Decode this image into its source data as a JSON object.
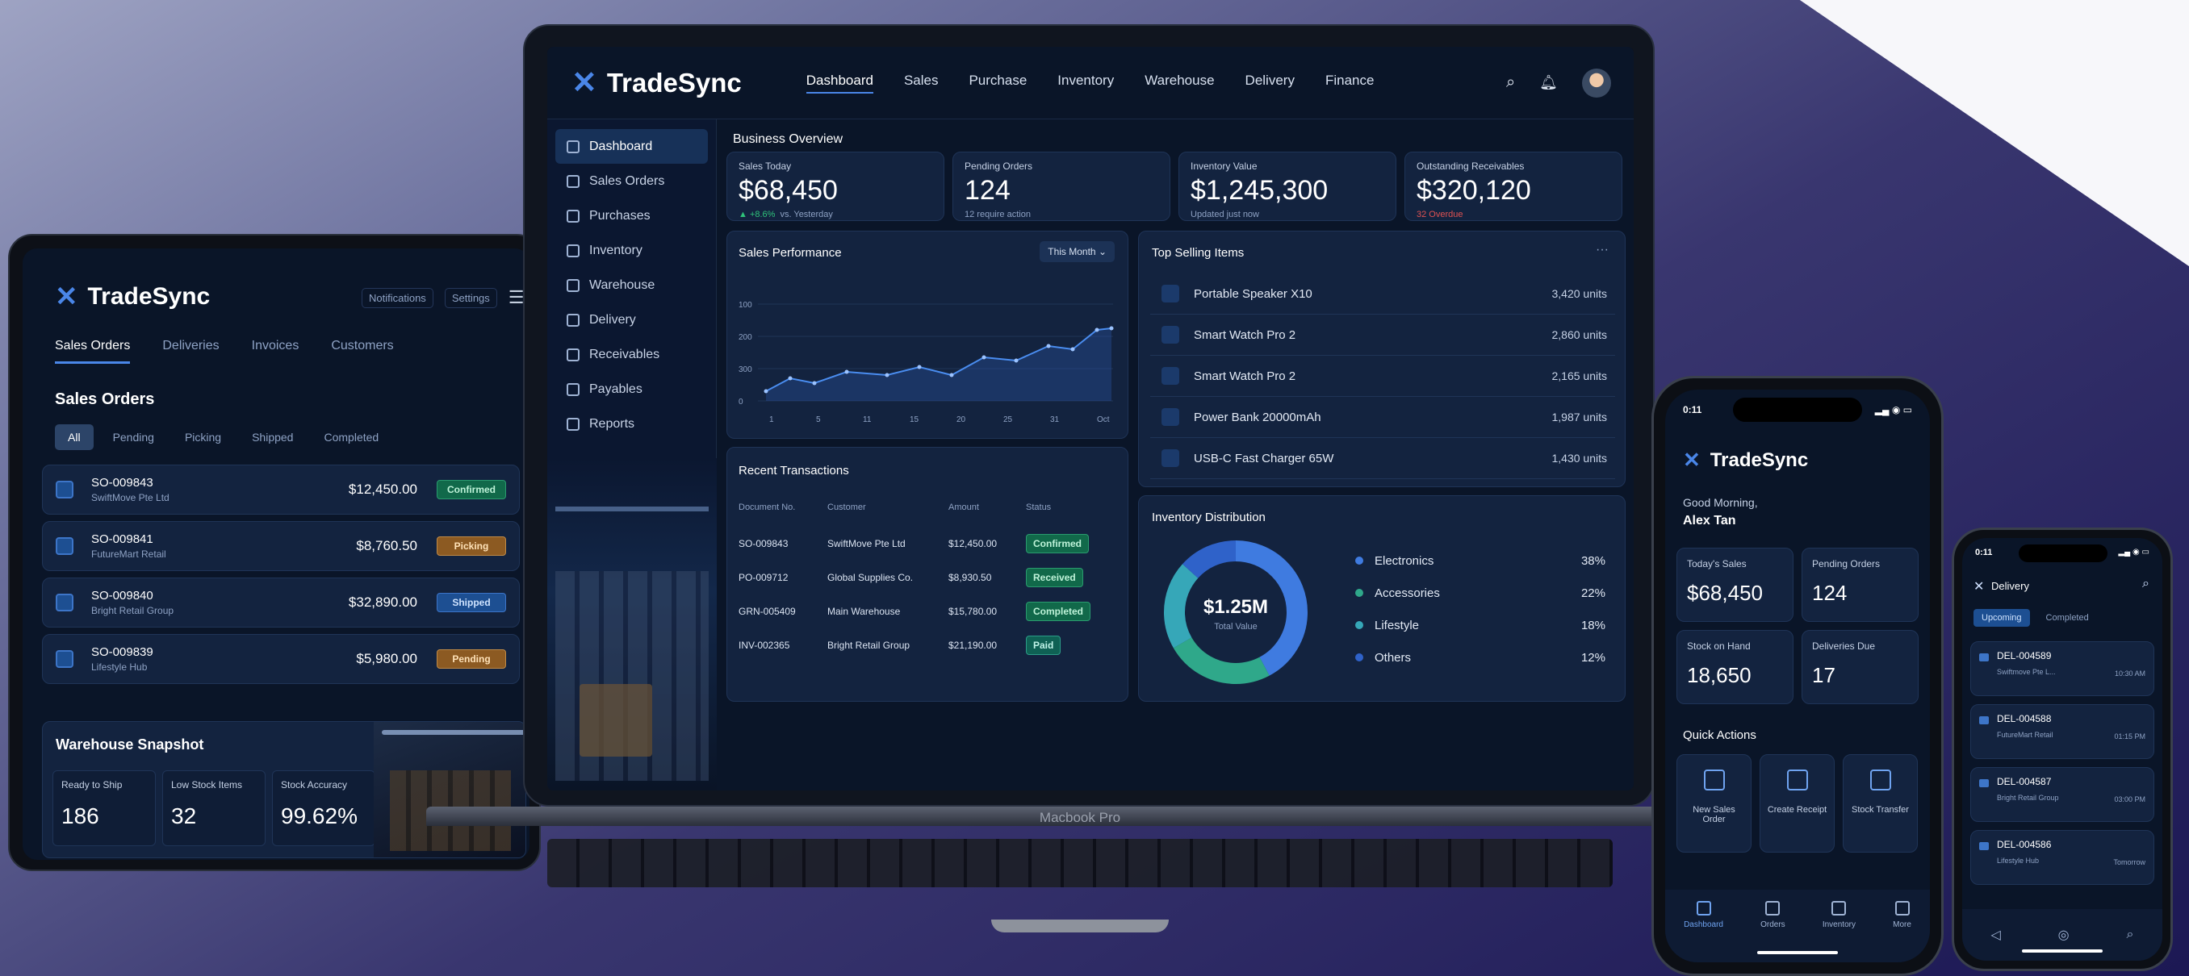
{
  "brand": {
    "name": "TradeSync",
    "accent": "#4a86e8"
  },
  "laptop": {
    "nav": [
      "Dashboard",
      "Sales",
      "Purchase",
      "Inventory",
      "Warehouse",
      "Delivery",
      "Finance"
    ],
    "sidebar": [
      "Dashboard",
      "Sales Orders",
      "Purchases",
      "Inventory",
      "Warehouse",
      "Delivery",
      "Receivables",
      "Payables",
      "Reports"
    ],
    "overview_title": "Business Overview",
    "kpis": [
      {
        "label": "Sales Today",
        "value": "$68,450",
        "note_a": "▲ +8.6%",
        "note_b": "vs. Yesterday"
      },
      {
        "label": "Pending Orders",
        "value": "124",
        "note_a": "12 require action",
        "note_b": ""
      },
      {
        "label": "Inventory Value",
        "value": "$1,245,300",
        "note_a": "Updated just now",
        "note_b": ""
      },
      {
        "label": "Outstanding Receivables",
        "value": "$320,120",
        "note_a": "32 Overdue",
        "note_b": ""
      }
    ],
    "sales_perf": {
      "title": "Sales Performance",
      "filter": "This Month",
      "yticks": [
        "100",
        "200",
        "300",
        "0"
      ],
      "xticks": [
        "1",
        "5",
        "11",
        "15",
        "20",
        "25",
        "31",
        "Oct"
      ]
    },
    "top_selling": {
      "title": "Top Selling Items",
      "more": "···",
      "items": [
        {
          "name": "Portable Speaker X10",
          "units": "3,420 units"
        },
        {
          "name": "Smart Watch Pro 2",
          "units": "2,860 units"
        },
        {
          "name": "Smart Watch Pro 2",
          "units": "2,165 units"
        },
        {
          "name": "Power Bank 20000mAh",
          "units": "1,987 units"
        },
        {
          "name": "USB-C Fast Charger 65W",
          "units": "1,430 units"
        }
      ]
    },
    "recent": {
      "title": "Recent Transactions",
      "headers": [
        "Document No.",
        "Customer",
        "Amount",
        "Status"
      ],
      "rows": [
        {
          "doc": "SO-009843",
          "customer": "SwiftMove Pte Ltd",
          "amount": "$12,450.00",
          "status": "Confirmed"
        },
        {
          "doc": "PO-009712",
          "customer": "Global Supplies Co.",
          "amount": "$8,930.50",
          "status": "Received"
        },
        {
          "doc": "GRN-005409",
          "customer": "Main Warehouse",
          "amount": "$15,780.00",
          "status": "Completed"
        },
        {
          "doc": "INV-002365",
          "customer": "Bright Retail Group",
          "amount": "$21,190.00",
          "status": "Paid"
        }
      ]
    },
    "donut": {
      "title": "Inventory Distribution",
      "center": "$1.25M",
      "center_sub": "Total Value",
      "items": [
        {
          "name": "Electronics",
          "pct": "38%",
          "color": "#3f7be0"
        },
        {
          "name": "Accessories",
          "pct": "22%",
          "color": "#2fa88a"
        },
        {
          "name": "Lifestyle",
          "pct": "18%",
          "color": "#36a7b8"
        },
        {
          "name": "Others",
          "pct": "12%",
          "color": "#2f62c9"
        }
      ]
    },
    "base_label": "Macbook Pro"
  },
  "tablet": {
    "header_btns": [
      "Notifications",
      "Settings"
    ],
    "tabs": [
      "Sales Orders",
      "Deliveries",
      "Invoices",
      "Customers"
    ],
    "section": "Sales Orders",
    "filters": [
      "All",
      "Pending",
      "Picking",
      "Shipped",
      "Completed"
    ],
    "orders": [
      {
        "id": "SO-009843",
        "cust": "SwiftMove Pte Ltd",
        "amount": "$12,450.00",
        "status": "Confirmed"
      },
      {
        "id": "SO-009841",
        "cust": "FutureMart Retail",
        "amount": "$8,760.50",
        "status": "Picking"
      },
      {
        "id": "SO-009840",
        "cust": "Bright Retail Group",
        "amount": "$32,890.00",
        "status": "Shipped"
      },
      {
        "id": "SO-009839",
        "cust": "Lifestyle Hub",
        "amount": "$5,980.00",
        "status": "Pending"
      }
    ],
    "warehouse": {
      "title": "Warehouse Snapshot",
      "cells": [
        {
          "label": "Ready to Ship",
          "value": "186"
        },
        {
          "label": "Low Stock Items",
          "value": "32"
        },
        {
          "label": "Stock Accuracy",
          "value": "99.62%"
        }
      ]
    }
  },
  "phone1": {
    "time": "0:11",
    "greeting": "Good Morning,",
    "name": "Alex Tan",
    "cards": [
      {
        "label": "Today's Sales",
        "value": "$68,450"
      },
      {
        "label": "Pending Orders",
        "value": "124"
      },
      {
        "label": "Stock on Hand",
        "value": "18,650"
      },
      {
        "label": "Deliveries Due",
        "value": "17"
      }
    ],
    "quick_title": "Quick Actions",
    "quick": [
      "New Sales Order",
      "Create Receipt",
      "Stock Transfer"
    ],
    "tabs": [
      "Dashboard",
      "Orders",
      "Inventory",
      "More"
    ]
  },
  "phone2": {
    "time": "0:11",
    "title": "Delivery",
    "tabs": [
      "Upcoming",
      "Completed"
    ],
    "items": [
      {
        "id": "DEL-004589",
        "sub": "Swiftmove Pte L...",
        "time": "10:30 AM"
      },
      {
        "id": "DEL-004588",
        "sub": "FutureMart Retail",
        "time": "01:15 PM"
      },
      {
        "id": "DEL-004587",
        "sub": "Bright Retail Group",
        "time": "03:00 PM"
      },
      {
        "id": "DEL-004586",
        "sub": "Lifestyle Hub",
        "time": "Tomorrow"
      }
    ]
  }
}
